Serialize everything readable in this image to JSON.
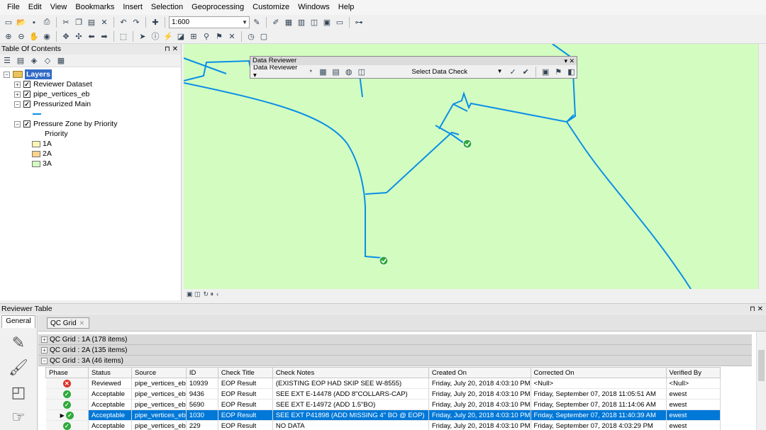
{
  "menu": [
    "File",
    "Edit",
    "View",
    "Bookmarks",
    "Insert",
    "Selection",
    "Geoprocessing",
    "Customize",
    "Windows",
    "Help"
  ],
  "toolbar": {
    "scale": "1:600"
  },
  "toc": {
    "title": "Table Of Contents",
    "root": "Layers",
    "layers": [
      {
        "label": "Reviewer Dataset",
        "checked": true
      },
      {
        "label": "pipe_vertices_eb",
        "checked": true
      },
      {
        "label": "Pressurized Main",
        "checked": true
      },
      {
        "label": "Pressure Zone by Priority",
        "checked": true
      }
    ],
    "legend_heading": "Priority",
    "legend": [
      {
        "label": "1A",
        "color": "#fef6b8"
      },
      {
        "label": "2A",
        "color": "#fbd38c"
      },
      {
        "label": "3A",
        "color": "#d3fcc0"
      }
    ]
  },
  "map": {
    "fill_color": "#d3fcc0",
    "line_color": "#0a8fe8"
  },
  "data_reviewer": {
    "title": "Data Reviewer",
    "menu_label": "Data Reviewer",
    "select_check": "Select Data Check"
  },
  "reviewer_table": {
    "title": "Reviewer Table",
    "side_tab": "General",
    "grid_tab": "QC Grid",
    "groups": [
      "QC Grid : 1A (178 items)",
      "QC Grid : 2A (135 items)",
      "QC Grid : 3A (46 items)"
    ],
    "columns": [
      "Phase",
      "Status",
      "Source",
      "ID",
      "Check Title",
      "Check Notes",
      "Created On",
      "Corrected On",
      "Verified By"
    ],
    "rows": [
      {
        "icon": "error",
        "status": "Reviewed",
        "source": "pipe_vertices_eb",
        "id": "10939",
        "check_title": "EOP Result",
        "notes": "(EXISTING EOP HAD SKIP SEE W-8555)",
        "created": "Friday, July 20, 2018 4:03:10 PM",
        "corrected": "<Null>",
        "verified": "<Null>"
      },
      {
        "icon": "ok",
        "status": "Acceptable",
        "source": "pipe_vertices_eb",
        "id": "9436",
        "check_title": "EOP Result",
        "notes": "SEE EXT E-14478  (ADD 8\"COLLARS-CAP)",
        "created": "Friday, July 20, 2018 4:03:10 PM",
        "corrected": "Friday, September 07, 2018 11:05:51 AM",
        "verified": "ewest"
      },
      {
        "icon": "ok",
        "status": "Acceptable",
        "source": "pipe_vertices_eb",
        "id": "5690",
        "check_title": "EOP Result",
        "notes": "SEE EXT E-14972  (ADD 1.5\"BO)",
        "created": "Friday, July 20, 2018 4:03:10 PM",
        "corrected": "Friday, September 07, 2018 11:14:06 AM",
        "verified": "ewest"
      },
      {
        "icon": "ok",
        "status": "Acceptable",
        "source": "pipe_vertices_eb",
        "id": "1030",
        "check_title": "EOP Result",
        "notes": "SEE EXT P41898  (ADD MISSING 4\" BO @ EOP)",
        "created": "Friday, July 20, 2018 4:03:10 PM",
        "corrected": "Friday, September 07, 2018 11:40:39 AM",
        "verified": "ewest",
        "selected": true
      },
      {
        "icon": "ok",
        "status": "Acceptable",
        "source": "pipe_vertices_eb",
        "id": "229",
        "check_title": "EOP Result",
        "notes": "NO DATA",
        "created": "Friday, July 20, 2018 4:03:10 PM",
        "corrected": "Friday, September 07, 2018 4:03:29 PM",
        "verified": "ewest"
      }
    ]
  }
}
